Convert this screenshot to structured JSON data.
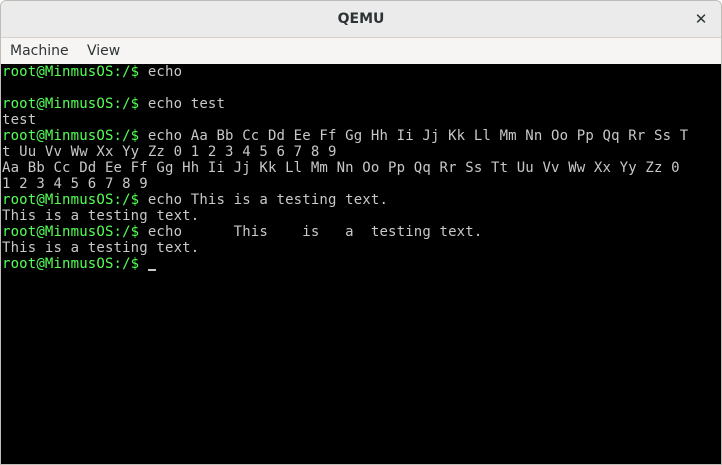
{
  "window": {
    "title": "QEMU",
    "close_glyph": "✕"
  },
  "menubar": {
    "items": [
      {
        "label": "Machine"
      },
      {
        "label": "View"
      }
    ]
  },
  "terminal": {
    "prompt": "root@MinmusOS:/$",
    "colors": {
      "background": "#000000",
      "prompt": "#55ff55",
      "text": "#c8c8c8"
    },
    "lines": [
      {
        "prompt": "root@MinmusOS:/$",
        "text": " echo"
      },
      {
        "prompt": "",
        "text": ""
      },
      {
        "prompt": "root@MinmusOS:/$",
        "text": " echo test"
      },
      {
        "prompt": "",
        "text": "test"
      },
      {
        "prompt": "root@MinmusOS:/$",
        "text": " echo Aa Bb Cc Dd Ee Ff Gg Hh Ii Jj Kk Ll Mm Nn Oo Pp Qq Rr Ss T"
      },
      {
        "prompt": "",
        "text": "t Uu Vv Ww Xx Yy Zz 0 1 2 3 4 5 6 7 8 9"
      },
      {
        "prompt": "",
        "text": "Aa Bb Cc Dd Ee Ff Gg Hh Ii Jj Kk Ll Mm Nn Oo Pp Qq Rr Ss Tt Uu Vv Ww Xx Yy Zz 0"
      },
      {
        "prompt": "",
        "text": "1 2 3 4 5 6 7 8 9"
      },
      {
        "prompt": "root@MinmusOS:/$",
        "text": " echo This is a testing text."
      },
      {
        "prompt": "",
        "text": "This is a testing text."
      },
      {
        "prompt": "root@MinmusOS:/$",
        "text": " echo      This    is   a  testing text."
      },
      {
        "prompt": "",
        "text": "This is a testing text."
      },
      {
        "prompt": "root@MinmusOS:/$",
        "text": " "
      }
    ]
  }
}
